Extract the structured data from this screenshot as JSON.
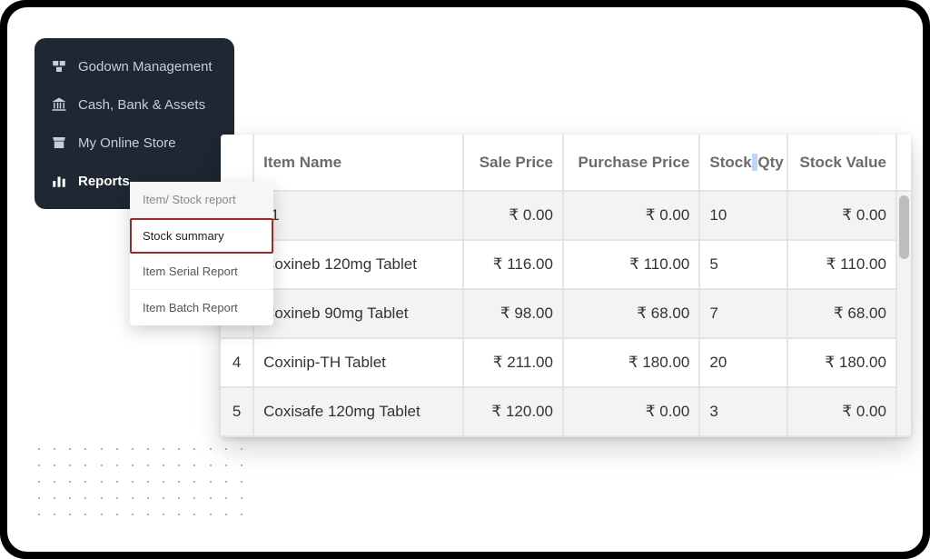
{
  "sidebar": {
    "items": [
      {
        "label": "Godown Management"
      },
      {
        "label": "Cash, Bank & Assets"
      },
      {
        "label": "My Online Store"
      },
      {
        "label": "Reports"
      }
    ]
  },
  "submenu": {
    "items": [
      {
        "label": "Item/ Stock report"
      },
      {
        "label": "Stock summary"
      },
      {
        "label": "Item Serial Report"
      },
      {
        "label": "Item Batch Report"
      }
    ]
  },
  "table": {
    "headers": {
      "item_name": "Item Name",
      "sale_price": "Sale Price",
      "purchase_price": "Purchase Price",
      "stock_qty_a": "Stock",
      "stock_qty_b": "Qty",
      "stock_value": "Stock Value"
    },
    "rows": [
      {
        "idx": "",
        "name": "11",
        "sale": "₹ 0.00",
        "purchase": "₹ 0.00",
        "qty": "10",
        "value": "₹ 0.00"
      },
      {
        "idx": "",
        "name": "Coxineb 120mg Tablet",
        "sale": "₹ 116.00",
        "purchase": "₹ 110.00",
        "qty": "5",
        "value": "₹ 110.00"
      },
      {
        "idx": "",
        "name": "Coxineb 90mg Tablet",
        "sale": "₹ 98.00",
        "purchase": "₹ 68.00",
        "qty": "7",
        "value": "₹ 68.00"
      },
      {
        "idx": "4",
        "name": "Coxinip-TH Tablet",
        "sale": "₹ 211.00",
        "purchase": "₹ 180.00",
        "qty": "20",
        "value": "₹ 180.00"
      },
      {
        "idx": "5",
        "name": "Coxisafe 120mg Tablet",
        "sale": "₹ 120.00",
        "purchase": "₹ 0.00",
        "qty": "3",
        "value": "₹ 0.00"
      }
    ]
  }
}
